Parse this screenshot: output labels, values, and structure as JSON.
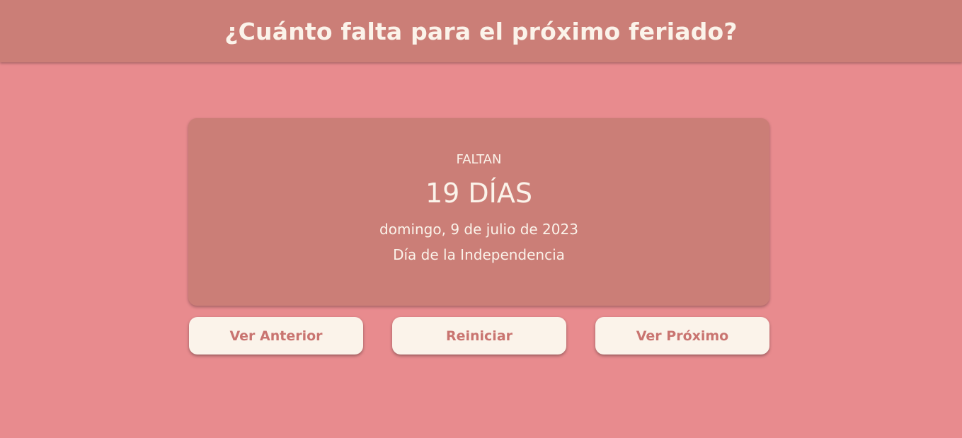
{
  "header": {
    "title": "¿Cuánto falta para el próximo feriado?"
  },
  "card": {
    "label": "FALTAN",
    "days": "19 DÍAS",
    "date": "domingo, 9 de julio de 2023",
    "holiday_name": "Día de la Independencia"
  },
  "buttons": {
    "previous": "Ver Anterior",
    "reset": "Reiniciar",
    "next": "Ver Próximo"
  },
  "colors": {
    "background": "#e88b8e",
    "panel": "#cb7e77",
    "text_light": "#fbf3ea",
    "button_text": "#c97470"
  }
}
